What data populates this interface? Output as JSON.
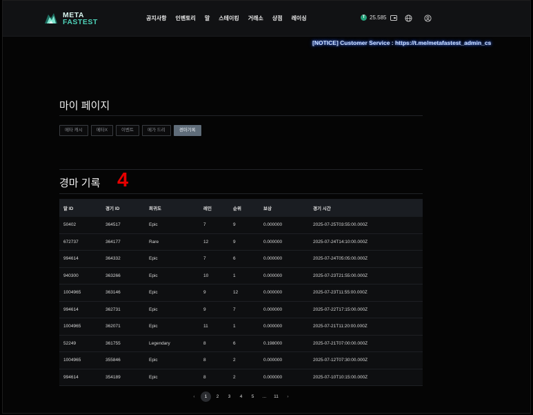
{
  "header": {
    "logo_line1": "META",
    "logo_line2": "FASTEST",
    "nav": [
      "공지사항",
      "인벤토리",
      "말",
      "스테이킹",
      "거래소",
      "상점",
      "레이싱"
    ],
    "balance": "25.585",
    "coin_symbol": "T"
  },
  "notice": "[NOTICE] Customer Service : https://t.me/metafastest_admin_cs",
  "page_title": "마이 페이지",
  "tabs": [
    {
      "label": "메타 캐시",
      "active": false
    },
    {
      "label": "메타X",
      "active": false
    },
    {
      "label": "이벤트",
      "active": false
    },
    {
      "label": "메가 드리",
      "active": false
    },
    {
      "label": "경마기록",
      "active": true
    }
  ],
  "section_title": "경마 기록",
  "annotation": "4",
  "table": {
    "headers": [
      "말 ID",
      "경기 ID",
      "희귀도",
      "레인",
      "순위",
      "보상",
      "경기 시간"
    ],
    "rows": [
      [
        "50402",
        "364517",
        "Epic",
        "7",
        "9",
        "0.000000",
        "2025-07-25T03:55:00.000Z"
      ],
      [
        "672737",
        "364177",
        "Rare",
        "12",
        "9",
        "0.000000",
        "2025-07-24T14:10:00.000Z"
      ],
      [
        "994614",
        "364332",
        "Epic",
        "7",
        "6",
        "0.000000",
        "2025-07-24T05:05:00.000Z"
      ],
      [
        "940300",
        "363266",
        "Epic",
        "10",
        "1",
        "0.000000",
        "2025-07-23T21:55:00.000Z"
      ],
      [
        "1004965",
        "363146",
        "Epic",
        "9",
        "12",
        "0.000000",
        "2025-07-23T11:55:00.000Z"
      ],
      [
        "994614",
        "362731",
        "Epic",
        "9",
        "7",
        "0.000000",
        "2025-07-22T17:15:00.000Z"
      ],
      [
        "1004965",
        "362071",
        "Epic",
        "11",
        "1",
        "0.000000",
        "2025-07-21T11:20:00.000Z"
      ],
      [
        "52249",
        "361755",
        "Legendary",
        "8",
        "6",
        "0.198000",
        "2025-07-21T07:00:00.000Z"
      ],
      [
        "1004965",
        "355846",
        "Epic",
        "8",
        "2",
        "0.000000",
        "2025-07-12T07:30:00.000Z"
      ],
      [
        "994614",
        "354189",
        "Epic",
        "8",
        "2",
        "0.000000",
        "2025-07-10T10:15:00.000Z"
      ]
    ]
  },
  "pagination": {
    "prev": "‹",
    "next": "›",
    "pages": [
      "1",
      "2",
      "3",
      "4",
      "5",
      "...",
      "11"
    ],
    "active": "1"
  }
}
